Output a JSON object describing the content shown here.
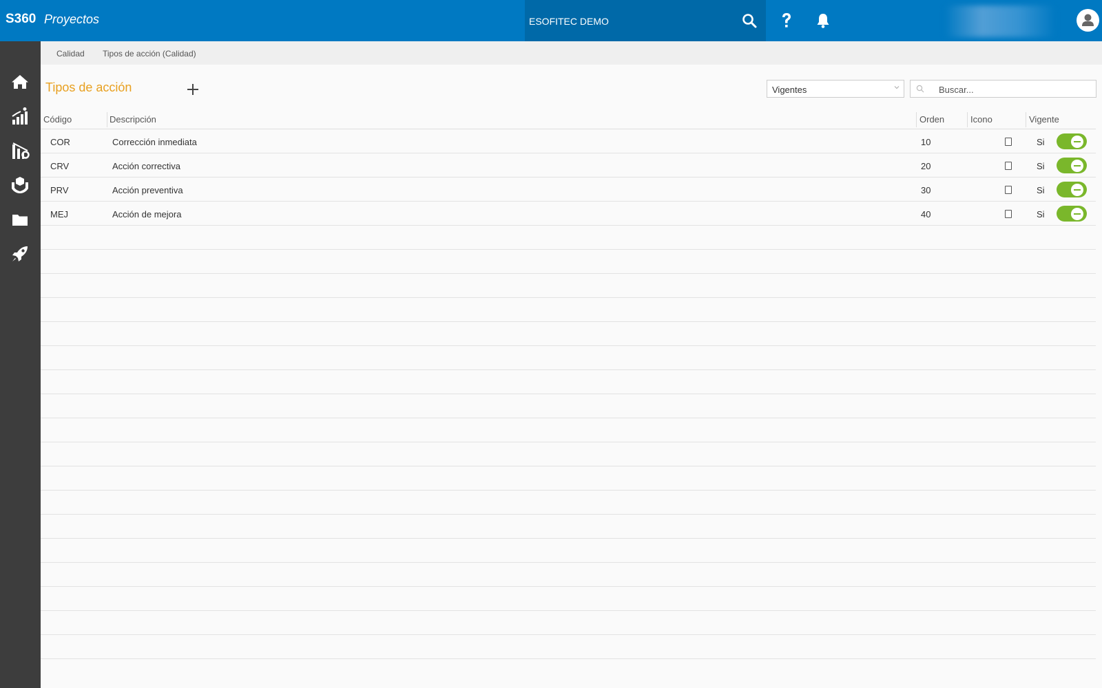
{
  "header": {
    "logo": "S360",
    "app_name": "Proyectos",
    "company": "ESOFITEC DEMO",
    "icons": [
      "search-icon",
      "help-icon",
      "bell-icon",
      "user-icon"
    ]
  },
  "sidebar": {
    "items": [
      {
        "name": "home-icon"
      },
      {
        "name": "stats-icon"
      },
      {
        "name": "chart-tools-icon"
      },
      {
        "name": "hands-box-icon"
      },
      {
        "name": "folder-icon"
      },
      {
        "name": "rocket-icon"
      }
    ]
  },
  "breadcrumb": [
    "Calidad",
    "Tipos de acción (Calidad)"
  ],
  "page": {
    "title": "Tipos de acción",
    "filter_value": "Vigentes",
    "search_placeholder": "Buscar..."
  },
  "table": {
    "columns": [
      "Código",
      "Descripción",
      "Orden",
      "Icono",
      "Vigente"
    ],
    "rows": [
      {
        "codigo": "COR",
        "descripcion": "Corrección inmediata",
        "orden": "10",
        "vigente": "Si"
      },
      {
        "codigo": "CRV",
        "descripcion": "Acción correctiva",
        "orden": "20",
        "vigente": "Si"
      },
      {
        "codigo": "PRV",
        "descripcion": "Acción preventiva",
        "orden": "30",
        "vigente": "Si"
      },
      {
        "codigo": "MEJ",
        "descripcion": "Acción de mejora",
        "orden": "40",
        "vigente": "Si"
      }
    ]
  },
  "colors": {
    "topbar": "#0079c2",
    "sidebar": "#3d3d3d",
    "title": "#e8a020",
    "toggle": "#7ab72b"
  }
}
